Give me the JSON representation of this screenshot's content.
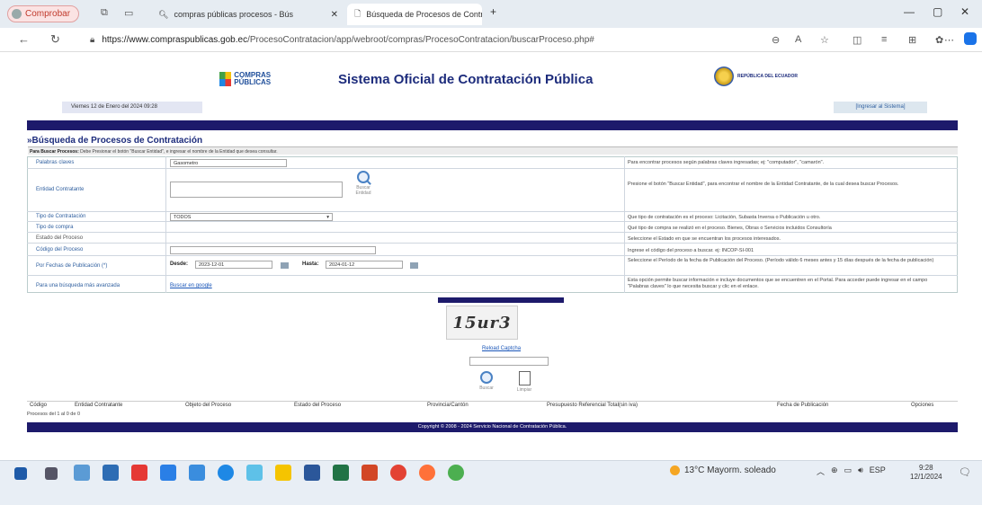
{
  "browser": {
    "comprobar_label": "Comprobar",
    "tab_inactive_title": "compras públicas procesos - Bús",
    "tab_active_title": "Búsqueda de Procesos de Contr",
    "url_prefix": "https://www.compraspublicas.gob.ec",
    "url_path": "/ProcesoContratacion/app/webroot/compras/ProcesoContratacion/buscarProceso.php#"
  },
  "header": {
    "logo_compras": "COMPRAS PÚBLICAS",
    "title": "Sistema Oficial de Contratación Pública",
    "logo_ecuador": "REPÚBLICA DEL ECUADOR",
    "date": "Viernes 12 de Enero del 2024 09:28",
    "login_link": "[Ingresar al Sistema]"
  },
  "section": {
    "title": "»Búsqueda de Procesos de Contratación",
    "instructions_bold": "Para Buscar Procesos:",
    "instructions": "Debe Presionar el botón \"Buscar Entidad\", e ingresar el nombre de la Entidad que desea consultar."
  },
  "form": {
    "palabras_label": "Palabras claves",
    "palabras_value": "Gasometro",
    "palabras_desc": "Para encontrar procesos según palabras claves ingresadas; ej: \"computador\", \"camarón\".",
    "entidad_label": "Entidad Contratante",
    "entidad_button": "Buscar Entidad",
    "entidad_desc": "Presione el botón \"Buscar Entidad\", para encontrar el nombre de la Entidad Contratante, de la cual desea buscar Procesos.",
    "tipo_contratacion_label": "Tipo de Contratación",
    "tipo_contratacion_value": "TODOS",
    "tipo_contratacion_desc": "Que tipo de contratación es el proceso: Licitación, Subasta Inversa o Publicación u otro.",
    "tipo_compra_label": "Tipo de compra",
    "tipo_compra_desc": "Qué tipo de compra se realizó en el proceso. Bienes, Obras o Servicios incluidos Consultoría",
    "estado_label": "Estado del Proceso",
    "estado_desc": "Seleccione el Estado en que se encuentran los procesos interesados.",
    "codigo_label": "Código del Proceso",
    "codigo_desc": "Ingrese el código del proceso a buscar. ej: INCOP-SI-001",
    "fechas_label": "Por Fechas de Publicación (*)",
    "desde_label": "Desde:",
    "desde_value": "2023-12-01",
    "hasta_label": "Hasta:",
    "hasta_value": "2024-01-12",
    "fechas_desc": "Seleccione el Período de la fecha de Publicación del Proceso. (Período válido 6 meses antes y 15 días después de la fecha de publicación)",
    "avanzada_label": "Para una búsqueda más avanzada",
    "avanzada_link": "Buscar en google",
    "avanzada_desc": "Esta opción permite buscar información e incluye documentos que se encuentren en el Portal. Para acceder puede ingresar en el campo \"Palabras claves\" lo que necesita buscar y clic en el enlace."
  },
  "captcha": {
    "text": "15ur3",
    "reload": "Reload Captcha",
    "buscar": "Buscar",
    "limpiar": "Limpiar"
  },
  "results": {
    "columns": [
      "Código",
      "Entidad Contratante",
      "Objeto del Proceso",
      "Estado del Proceso",
      "Provincia/Cantón",
      "Presupuesto Referencial Total(sin iva)",
      "Fecha de Publicación",
      "Opciones"
    ],
    "count": "Procesos del 1 al 0 de 0"
  },
  "footer": "Copyright © 2008 - 2024 Servicio Nacional de Contratación Pública.",
  "taskbar": {
    "weather": "13°C  Mayorm. soleado",
    "lang": "ESP",
    "time": "9:28",
    "date": "12/1/2024"
  },
  "colors": {
    "navy": "#1d1a6b",
    "link": "#2f5f9f",
    "title": "#1d2c7c"
  }
}
